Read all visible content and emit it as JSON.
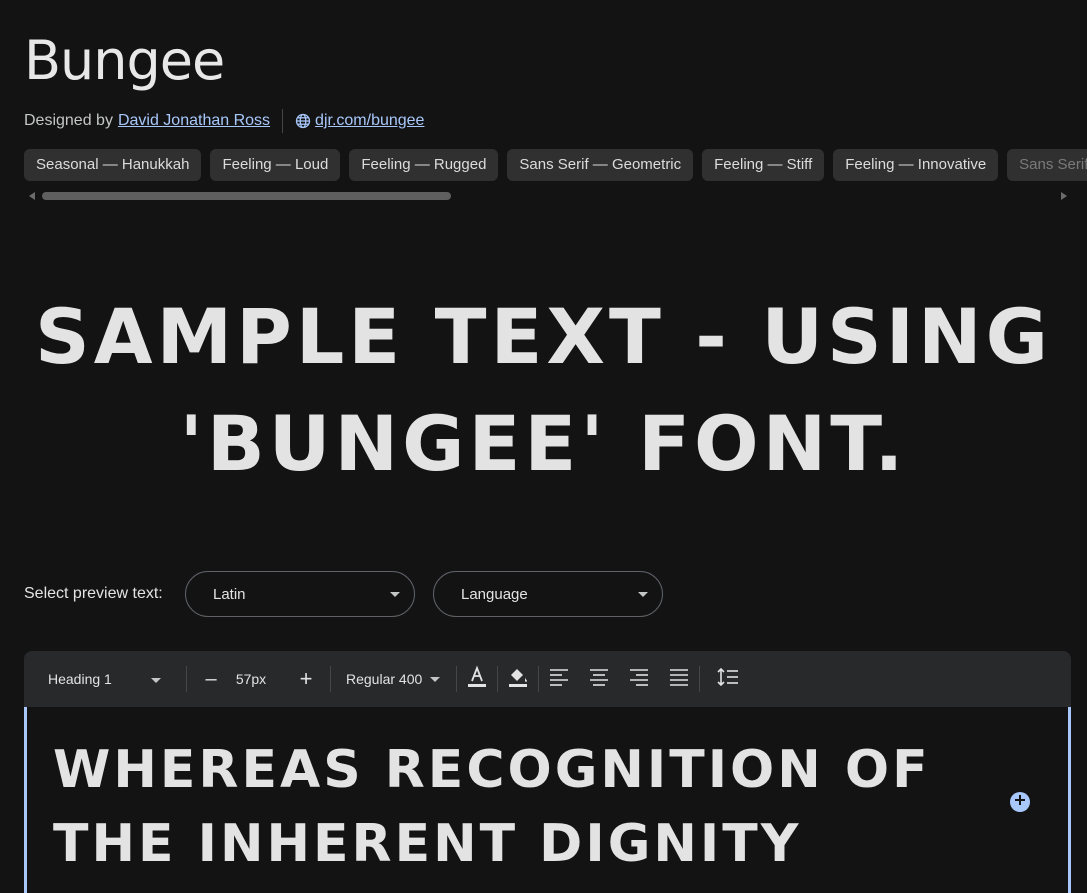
{
  "font": {
    "name": "Bungee",
    "designed_by_prefix": "Designed by",
    "designer": "David Jonathan Ross",
    "website": "djr.com/bungee"
  },
  "tags": [
    "Seasonal — Hanukkah",
    "Feeling — Loud",
    "Feeling — Rugged",
    "Sans Serif — Geometric",
    "Feeling — Stiff",
    "Feeling — Innovative",
    "Sans Serif"
  ],
  "sample": {
    "line1": "SAMPLE TEXT - USING",
    "line2": "'BUNGEE' FONT."
  },
  "preview": {
    "label": "Select preview text:",
    "script": "Latin",
    "language": "Language"
  },
  "toolbar": {
    "style": "Heading 1",
    "size": "57px",
    "weight": "Regular 400",
    "decrease": "–",
    "increase": "+"
  },
  "editor": {
    "line1": "WHEREAS RECOGNITION OF",
    "line2": "THE INHERENT DIGNITY"
  },
  "icons": [
    "globe-icon",
    "text-color-icon",
    "highlight-color-icon",
    "align-left-icon",
    "align-center-icon",
    "align-right-icon",
    "align-justify-icon",
    "line-height-icon",
    "add-icon"
  ],
  "colors": {
    "background": "#131314",
    "accent": "#a8c7fa",
    "chip": "#303030",
    "toolbar": "#28292a"
  }
}
